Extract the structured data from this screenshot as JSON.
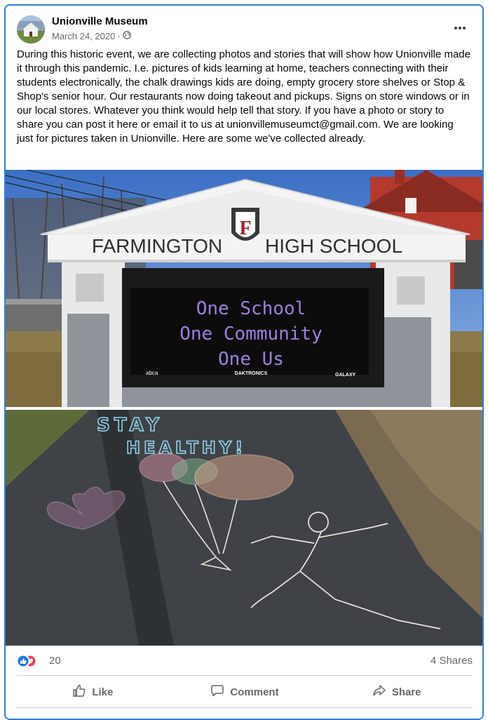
{
  "post": {
    "page_name": "Unionville Museum",
    "date": "March 24, 2020",
    "separator": "·",
    "body": "During this historic event, we are collecting photos and stories that will show how Unionville made it through this pandemic.  I.e. pictures of kids learning at home, teachers connecting with their students electronically, the chalk drawings kids are doing, empty grocery store shelves or Stop & Shop's senior hour. Our restaurants now doing takeout and pickups.  Signs on store windows or in our local stores. Whatever you think would help tell that story.  If you have a photo or story to share you can post it here or email it to us at unionvillemuseumct@gmail.com.  We are looking just for pictures taken in Unionville.  Here are some we've collected already."
  },
  "photo1": {
    "sign_left": "FARMINGTON",
    "sign_right": "HIGH SCHOOL",
    "crest_letter": "F",
    "led_line1": "One School",
    "led_line2": "One Community",
    "led_line3": "One Us",
    "brand_left": "abca",
    "brand_mid": "DAKTRONICS",
    "brand_right": "GALAXY"
  },
  "photo2": {
    "chalk_line1": "STAY",
    "chalk_line2": "HEALTHY!"
  },
  "footer": {
    "reaction_count": "20",
    "shares": "4 Shares",
    "like_label": "Like",
    "comment_label": "Comment",
    "share_label": "Share"
  },
  "icons": {
    "globe": "globe-icon",
    "more": "more-options-icon",
    "like": "like-icon",
    "comment": "comment-icon",
    "share": "share-icon"
  },
  "colors": {
    "card_border": "#2f7fdc",
    "like_blue": "#1877f2",
    "love_red": "#f33e58",
    "secondary_text": "#65676b"
  }
}
